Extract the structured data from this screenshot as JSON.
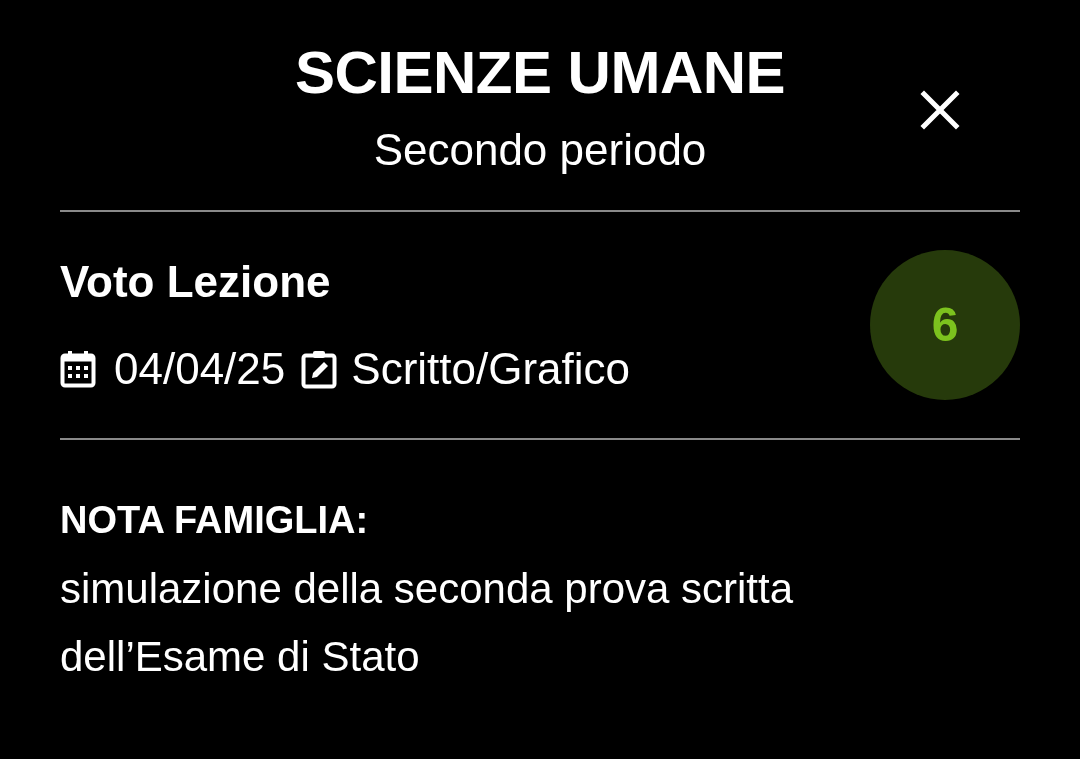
{
  "header": {
    "title": "SCIENZE UMANE",
    "subtitle": "Secondo periodo"
  },
  "grade": {
    "description": "Voto Lezione",
    "date": "04/04/25",
    "type": "Scritto/Grafico",
    "value": "6"
  },
  "note": {
    "label": "NOTA FAMIGLIA:",
    "text": "simulazione della seconda prova scritta dell’Esame di Stato"
  }
}
